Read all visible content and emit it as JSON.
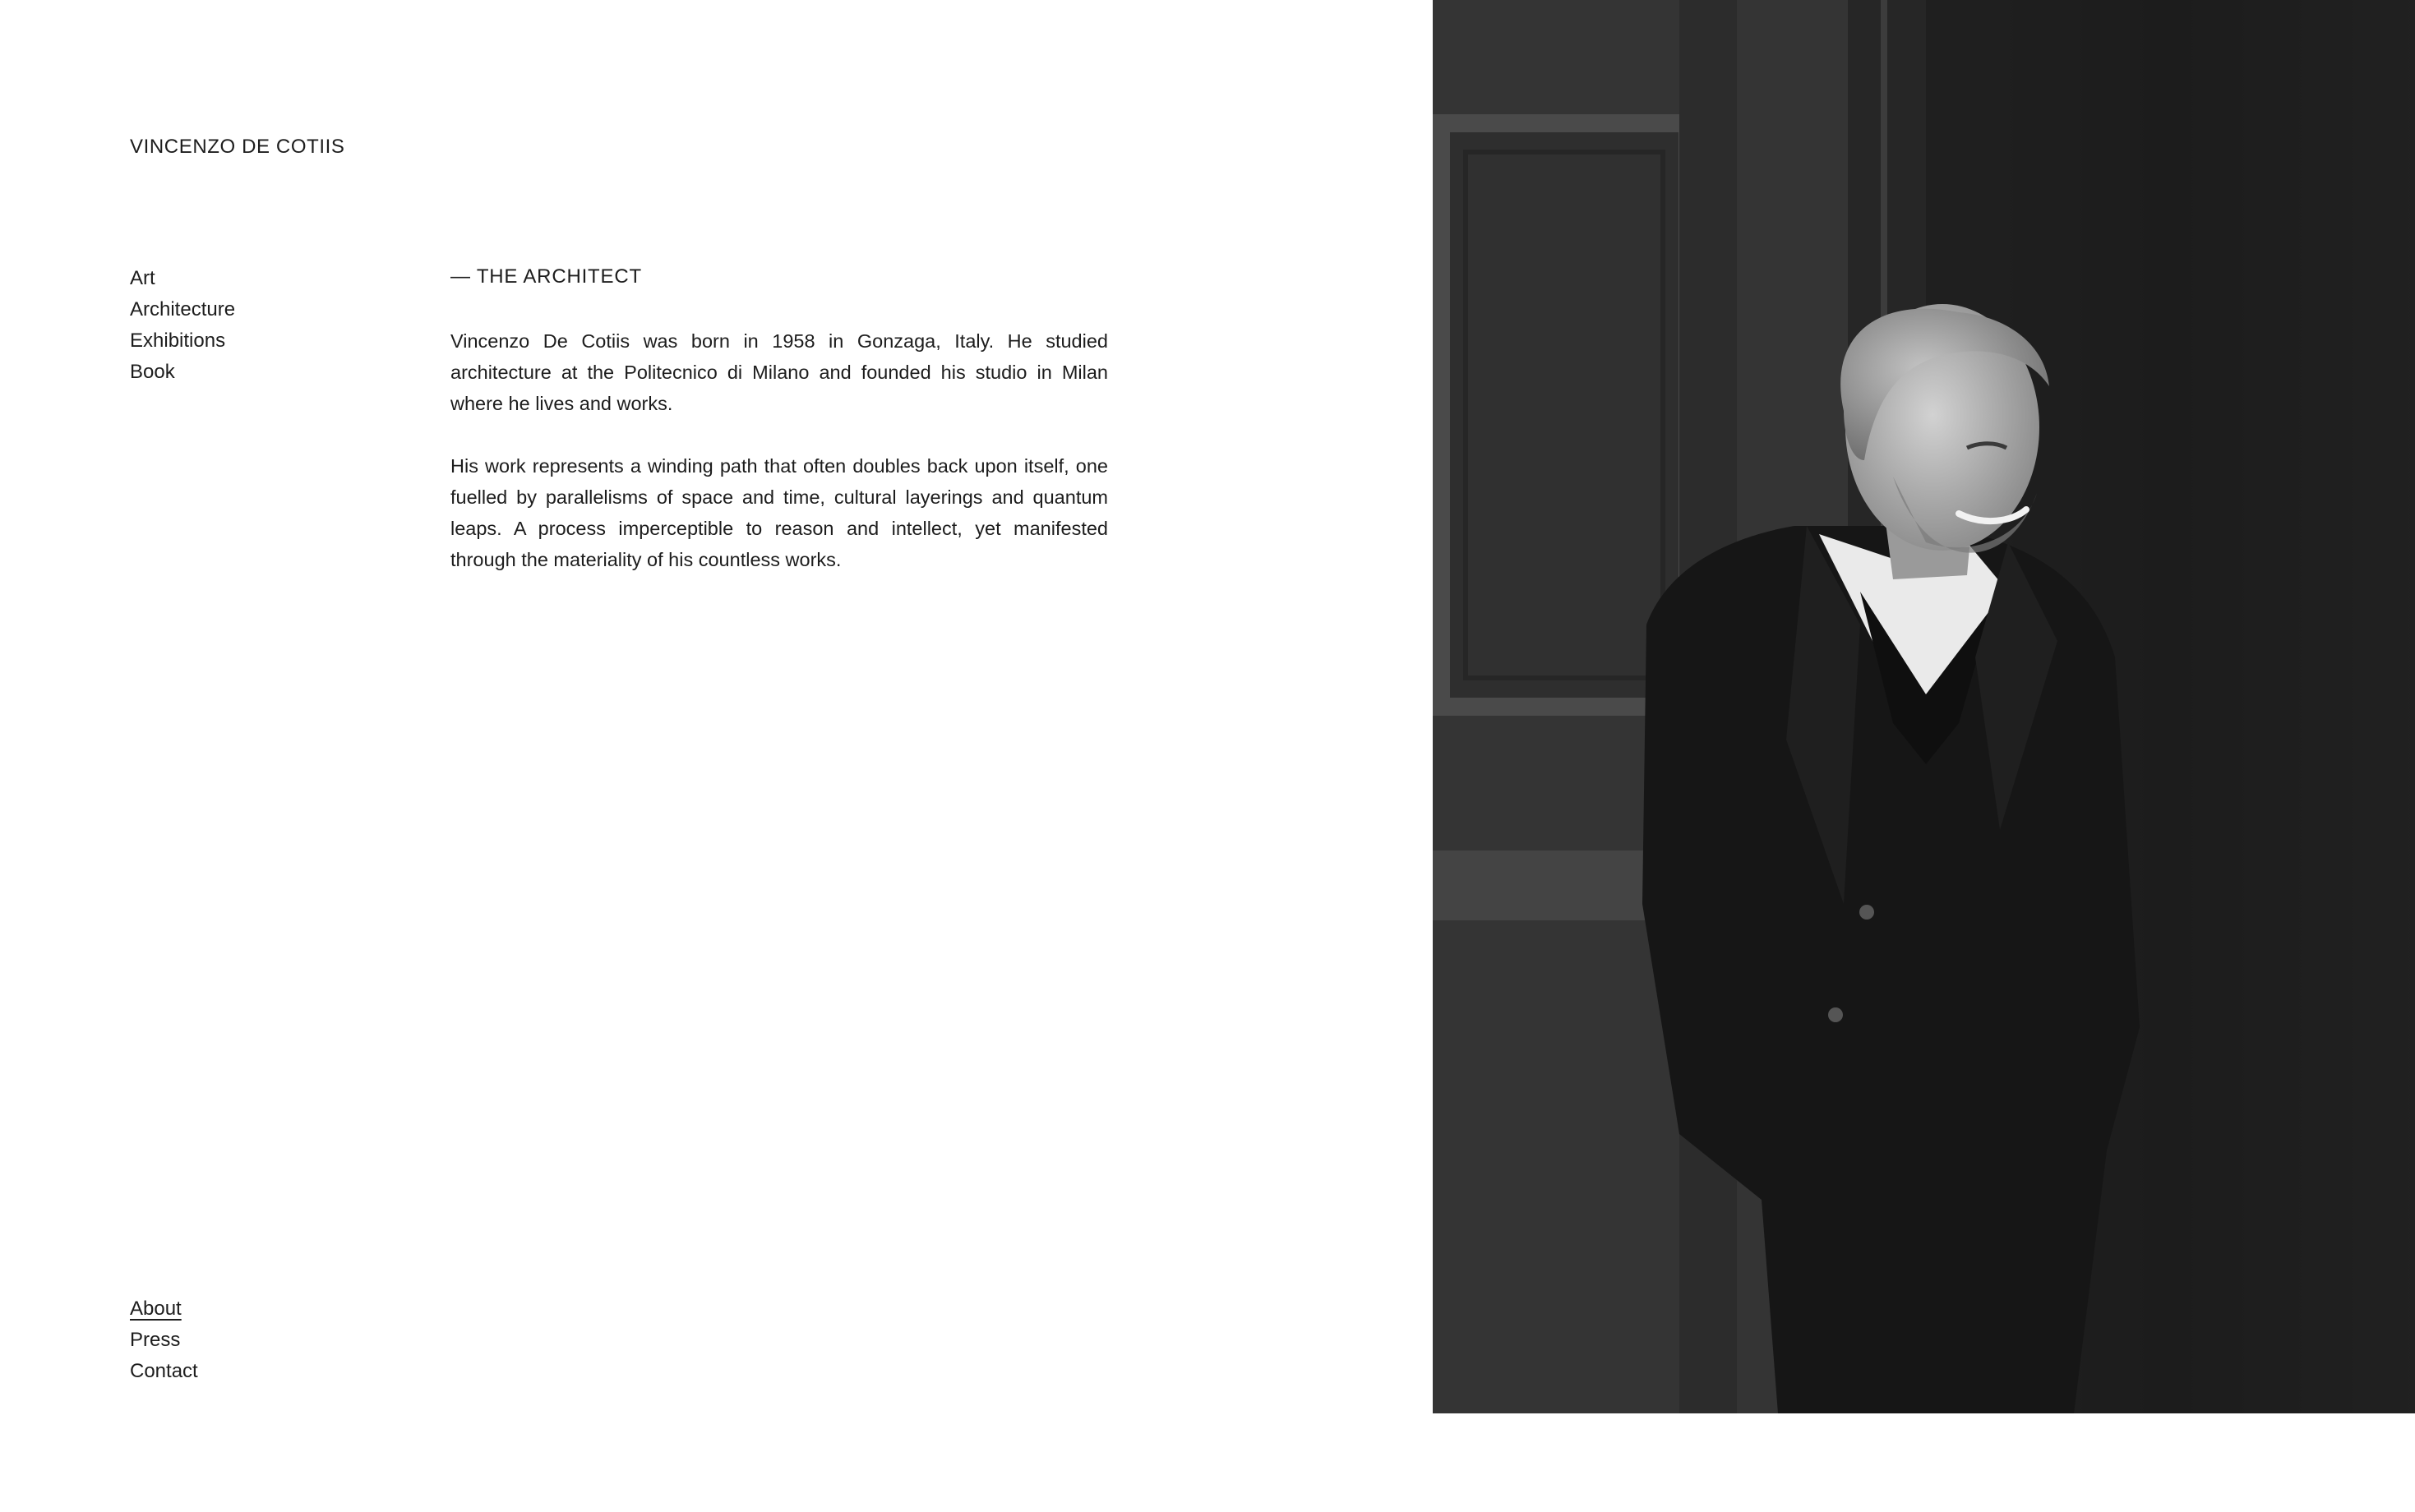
{
  "site": {
    "title": "VINCENZO DE COTIIS"
  },
  "nav": {
    "items": [
      {
        "label": "Art"
      },
      {
        "label": "Architecture"
      },
      {
        "label": "Exhibitions"
      },
      {
        "label": "Book"
      }
    ]
  },
  "content": {
    "heading": "— THE ARCHITECT",
    "paragraphs": [
      "Vincenzo De Cotiis was born in 1958 in Gonzaga, Italy. He studied architecture at the Politecnico di Milano and founded his studio in Milan where he lives and works.",
      "His work represents a winding path that often doubles back upon itself, one fuelled by parallelisms of space and time, cultural layerings and quantum leaps. A process imperceptible to reason and intellect, yet manifested through the materiality of his countless works."
    ]
  },
  "footer_nav": {
    "items": [
      {
        "label": "About",
        "active": true
      },
      {
        "label": "Press"
      },
      {
        "label": "Contact"
      }
    ]
  },
  "portrait": {
    "style": "black-and-white photograph",
    "colors": {
      "wall": "#2b2b2b",
      "panel": "#3a3a3a",
      "jacket": "#151515",
      "shirt": "#eeeeee",
      "skin": "#b9b9b9",
      "hair": "#9a9a9a"
    }
  }
}
